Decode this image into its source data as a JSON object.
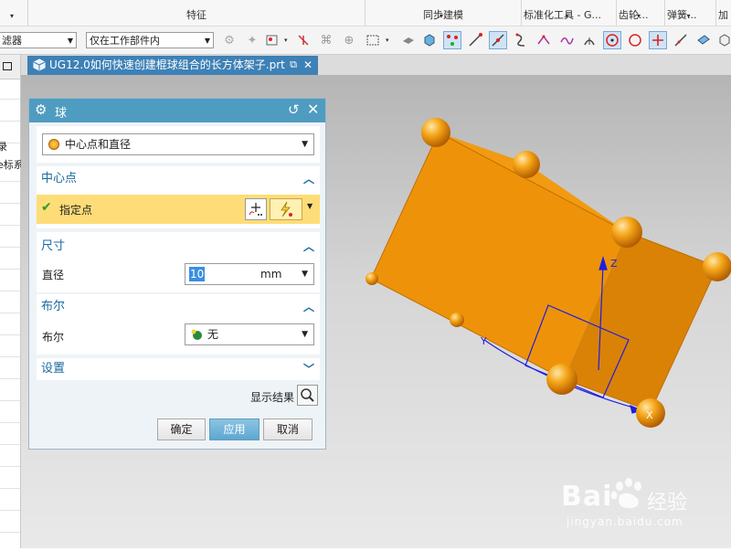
{
  "ribbon": {
    "groups": [
      {
        "label": "特征",
        "dropdown": false
      },
      {
        "label": "同步建模",
        "dropdown": true
      },
      {
        "label": "标准化工具 - G...",
        "dropdown": true
      },
      {
        "label": "齿轮...",
        "dropdown": true
      },
      {
        "label": "弹簧...",
        "dropdown": true
      },
      {
        "label": "加",
        "dropdown": false
      }
    ]
  },
  "toolbar": {
    "filter_combo": "滤器",
    "scope_combo": "仅在工作部件内"
  },
  "document_tab": {
    "title": "UG12.0如何快速创建棍球组合的长方体架子.prt",
    "icons": [
      "nx-part-icon",
      "restore-icon",
      "close-icon"
    ]
  },
  "left_panel": {
    "fragments": [
      "录",
      "e标系"
    ]
  },
  "dialog": {
    "title": "球",
    "type_value": "中心点和直径",
    "center_section": {
      "header": "中心点",
      "specify_point": "指定点"
    },
    "size_section": {
      "header": "尺寸",
      "diameter_label": "直径",
      "diameter_value": "10",
      "diameter_unit": "mm"
    },
    "boolean_section": {
      "header": "布尔",
      "boolean_label": "布尔",
      "boolean_value": "无"
    },
    "settings_section": {
      "header": "设置"
    },
    "show_result": "显示结果",
    "ok_button": "确定",
    "apply_button": "应用",
    "cancel_button": "取消"
  },
  "viewport": {
    "axis_z": "Z",
    "axis_y": "Y",
    "axis_x": "X",
    "model_color": "#ef9208",
    "background": "#c9c9c9"
  },
  "watermark": {
    "brand": "Bai",
    "brand_suffix": "经验",
    "url": "jingyan.baidu.com"
  },
  "colors": {
    "dialog_title": "#4f9cc1",
    "section_header": "#1a6aa0",
    "active_row": "#fedd78",
    "tab_active": "#3d81b6"
  }
}
